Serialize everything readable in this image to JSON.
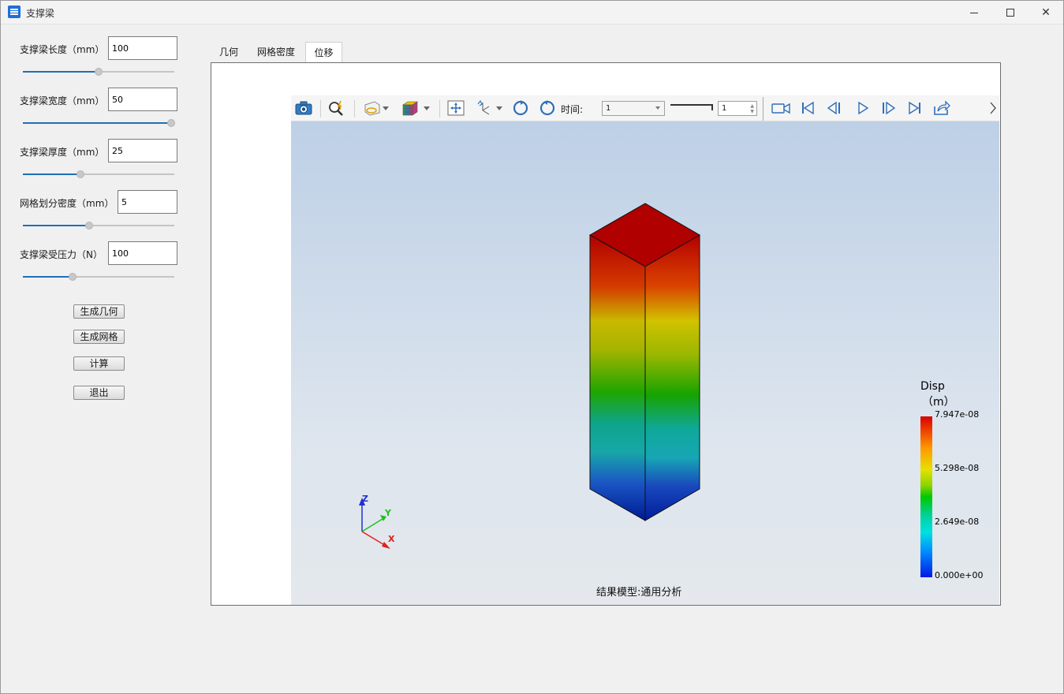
{
  "window": {
    "title": "支撑梁"
  },
  "params": [
    {
      "label": "支撑梁长度（mm）",
      "value": "100",
      "slider": 0.5
    },
    {
      "label": "支撑梁宽度（mm）",
      "value": "50",
      "slider": 1.0
    },
    {
      "label": "支撑梁厚度（mm）",
      "value": "25",
      "slider": 0.38
    },
    {
      "label": "网格划分密度（mm）",
      "value": "5",
      "slider": 0.44
    },
    {
      "label": "支撑梁受压力（N）",
      "value": "100",
      "slider": 0.33
    }
  ],
  "buttons": {
    "gen_geometry": "生成几何",
    "gen_mesh": "生成网格",
    "compute": "计算",
    "exit": "退出"
  },
  "tabs": [
    "几何",
    "网格密度",
    "位移"
  ],
  "active_tab": "位移",
  "toolbar": {
    "time_label": "时间:",
    "time_select": "1",
    "time_spin": "1"
  },
  "viewer": {
    "caption": "结果模型:通用分析",
    "legend": {
      "title": "Disp",
      "unit": "（m）",
      "values": [
        "7.947e-08",
        "5.298e-08",
        "2.649e-08",
        "0.000e+00"
      ]
    },
    "axes": {
      "x": "X",
      "y": "Y",
      "z": "Z"
    }
  },
  "colors": {
    "accent": "#1f6fb5",
    "bg": "#f0f0f0"
  }
}
